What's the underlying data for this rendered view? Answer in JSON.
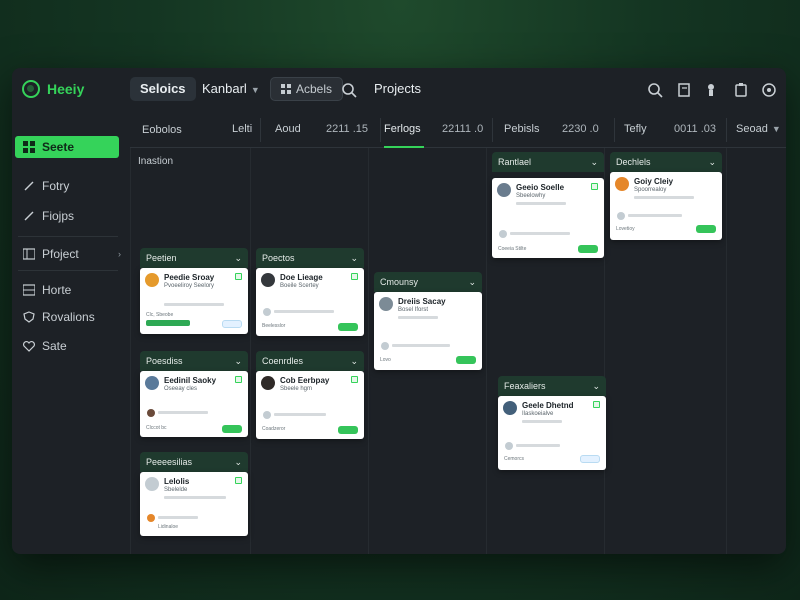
{
  "app": {
    "name": "Heeiy",
    "brand_color": "#35d35a"
  },
  "topnav": {
    "items": [
      {
        "label": "Seloics",
        "state": "active"
      },
      {
        "label": "Kanbarl",
        "has_dropdown": true
      },
      {
        "label": "Acbels",
        "icon": "grid-icon",
        "style": "outline"
      },
      {
        "label": "Projects"
      }
    ],
    "right_icons": [
      "search-icon",
      "document-icon",
      "user-icon",
      "clipboard-icon",
      "settings-icon"
    ]
  },
  "columns": [
    {
      "label": "Eobolos"
    },
    {
      "label": "Lelti"
    },
    {
      "label": "Aoud",
      "num": "2211 .15"
    },
    {
      "label": "Ferlogs",
      "num": "22111 .0",
      "active": true
    },
    {
      "label": "Pebisls",
      "num": "2230 .0"
    },
    {
      "label": "Tefly",
      "num": "0011 .03"
    },
    {
      "label": "Seoad",
      "has_dropdown": true
    }
  ],
  "sidebar": {
    "items": [
      {
        "label": "Seete",
        "icon": "grid-icon",
        "active": true
      },
      {
        "label": "Fotry",
        "icon": "pen-icon"
      },
      {
        "label": "Fiojps",
        "icon": "pen-icon"
      },
      {
        "label": "Pfoject",
        "icon": "board-icon",
        "has_chevron": true
      },
      {
        "label": "Horte",
        "icon": "board-icon"
      },
      {
        "label": "Rovalions",
        "icon": "shield-icon"
      },
      {
        "label": "Sate",
        "icon": "heart-icon"
      }
    ]
  },
  "board": {
    "lane_label": "Inastion",
    "groups": [
      {
        "header": "Peetien",
        "card": {
          "title": "Peedie Sroay",
          "sub": "Pvoeeliroy Seelory",
          "meta": "Clc, Sbeobe",
          "avatar_color": "#e59a2c"
        }
      },
      {
        "header": "Poectos",
        "card": {
          "title": "Doe Lieage",
          "sub": "Boeile Scertey",
          "meta": "Beelesslor",
          "avatar_color": "#34383c"
        }
      },
      {
        "header": "Cmounsy",
        "card": {
          "title": "Dreiis Sacay",
          "sub": "Bosel Iforst",
          "meta": "Lovo",
          "avatar_color": "#7c8b96"
        }
      },
      {
        "header": "Rantlael",
        "card": {
          "title": "Geeio Soelle",
          "sub": "Sbeelowhy",
          "meta": "Coeeia Stilte",
          "avatar_color": "#6a7c8e"
        }
      },
      {
        "header": "Dechlels",
        "card": {
          "title": "Goiy Cleiy",
          "sub": "Spoorrealoy",
          "meta": "Lovetioy",
          "avatar_color": "#e5872a"
        }
      },
      {
        "header": "Poesdiss",
        "card": {
          "title": "Eedinil Saoky",
          "sub": "Oseeay cles",
          "meta": "Clccot bc",
          "avatar_color": "#5a7a9a"
        }
      },
      {
        "header": "Coenrdles",
        "card": {
          "title": "Cob Eerbpay",
          "sub": "Sbeele hgm",
          "meta": "Coadzeror",
          "avatar_color": "#2f2a28"
        }
      },
      {
        "header": "Feaxaliers",
        "card": {
          "title": "Geele Dhetnd",
          "sub": "Ilaskoeialve",
          "meta": "Cemorcs",
          "avatar_color": "#43607a"
        }
      },
      {
        "header": "Peeeesilias",
        "card": {
          "title": "Lelolis",
          "sub": "Sbelelde",
          "meta": "Lidinaloe",
          "avatar_color": "#c3ccd2"
        }
      }
    ]
  }
}
